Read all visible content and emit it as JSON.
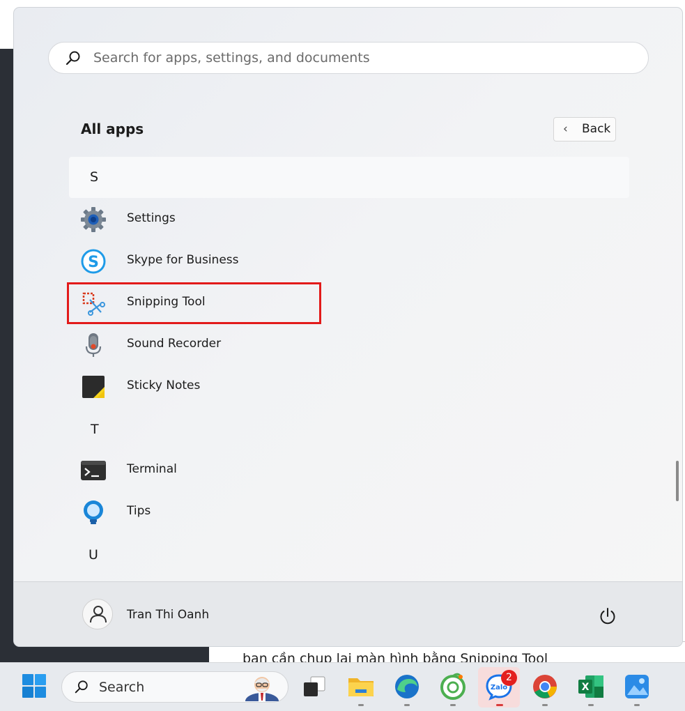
{
  "background": {
    "article_text": "bạn cần chụp lại màn hình bằng Snipping Tool"
  },
  "start_menu": {
    "search_placeholder": "Search for apps, settings, and documents",
    "all_apps_title": "All apps",
    "back_label": "Back",
    "sections": [
      {
        "letter": "S"
      },
      {
        "letter": "T"
      },
      {
        "letter": "U"
      }
    ],
    "apps": [
      {
        "name": "Settings",
        "icon": "gear-icon"
      },
      {
        "name": "Skype for Business",
        "icon": "skype-icon"
      },
      {
        "name": "Snipping Tool",
        "icon": "snipping-tool-icon",
        "highlighted": true
      },
      {
        "name": "Sound Recorder",
        "icon": "microphone-icon"
      },
      {
        "name": "Sticky Notes",
        "icon": "sticky-notes-icon"
      },
      {
        "name": "Terminal",
        "icon": "terminal-icon"
      },
      {
        "name": "Tips",
        "icon": "lightbulb-icon"
      }
    ],
    "user": {
      "name": "Tran Thi Oanh",
      "icon": "user-icon"
    },
    "power_icon": "power-icon",
    "highlight_color": "#e21a1a"
  },
  "taskbar": {
    "search_label": "Search",
    "zalo_badge": "2",
    "apps": [
      "start-icon",
      "task-view-icon",
      "file-explorer-icon",
      "edge-icon",
      "coccoc-icon",
      "zalo-icon",
      "chrome-icon",
      "excel-icon",
      "photos-icon"
    ]
  }
}
